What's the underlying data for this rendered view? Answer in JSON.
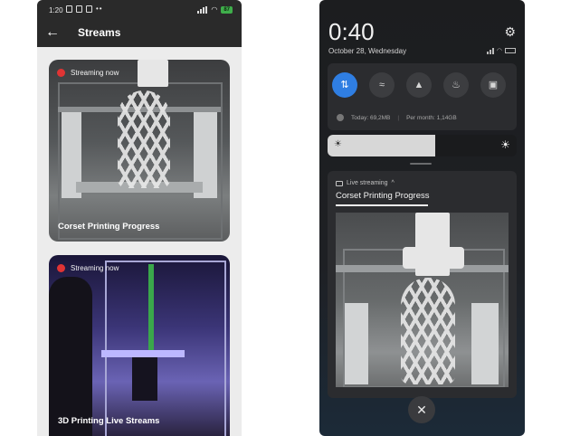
{
  "left_phone": {
    "status_bar": {
      "time": "1:20",
      "battery": "87"
    },
    "app_bar": {
      "title": "Streams"
    },
    "streams": [
      {
        "badge": "Streaming now",
        "title": "Corset Printing Progress"
      },
      {
        "badge": "Streaming now",
        "title": "3D Printing Live Streams"
      }
    ]
  },
  "right_phone": {
    "clock": "0:40",
    "date": "October 28, Wednesday",
    "quick_settings": {
      "tiles": [
        "data-transfer-icon",
        "wifi-icon",
        "flashlight-icon",
        "bell-icon",
        "screenshot-icon"
      ],
      "active_tile_index": 0,
      "data_today": "Today: 69,2MB",
      "data_month": "Per month: 1,14GB"
    },
    "brightness_level": 0.57,
    "notification": {
      "source": "Live streaming",
      "title": "Corset Printing Progress"
    }
  },
  "colors": {
    "live_dot": "#e03434",
    "active_tile": "#2f7ee2",
    "battery": "#3fae4b"
  }
}
